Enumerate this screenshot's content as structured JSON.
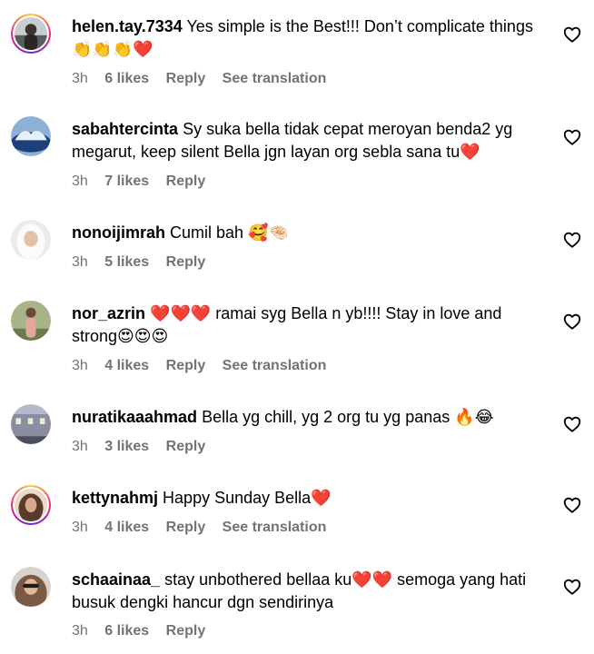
{
  "comments": [
    {
      "username": "helen.tay.7334",
      "text": "Yes simple is the Best!!! Don’t complicate things 👏👏👏❤️",
      "time": "3h",
      "likes": "6 likes",
      "reply": "Reply",
      "translation": "See translation"
    },
    {
      "username": "sabahtercinta",
      "text": "Sy suka bella tidak cepat meroyan benda2 yg megarut, keep silent Bella jgn layan org sebla sana tu❤️",
      "time": "3h",
      "likes": "7 likes",
      "reply": "Reply"
    },
    {
      "username": "nonoijimrah",
      "text": "Cumil bah 🥰🤏🏻",
      "time": "3h",
      "likes": "5 likes",
      "reply": "Reply"
    },
    {
      "username": "nor_azrin",
      "text": "❤️❤️❤️ ramai syg Bella n yb!!!! Stay in love and strong😍😍😍",
      "time": "3h",
      "likes": "4 likes",
      "reply": "Reply",
      "translation": "See translation"
    },
    {
      "username": "nuratikaaahmad",
      "text": "Bella yg chill, yg 2 org tu yg panas 🔥😂",
      "time": "3h",
      "likes": "3 likes",
      "reply": "Reply"
    },
    {
      "username": "kettynahmj",
      "text": "Happy Sunday Bella❤️",
      "time": "3h",
      "likes": "4 likes",
      "reply": "Reply",
      "translation": "See translation"
    },
    {
      "username": "schaainaa_",
      "text": "stay unbothered bellaa ku❤️❤️ semoga yang hati busuk dengki hancur dgn sendirinya",
      "time": "3h",
      "likes": "6 likes",
      "reply": "Reply"
    }
  ],
  "colors": {
    "meta_gray": "#737373",
    "ring_gradient": [
      "#f9ce34",
      "#ee2a7b",
      "#6228d7"
    ]
  },
  "icons": {
    "like": "heart-outline-icon"
  }
}
